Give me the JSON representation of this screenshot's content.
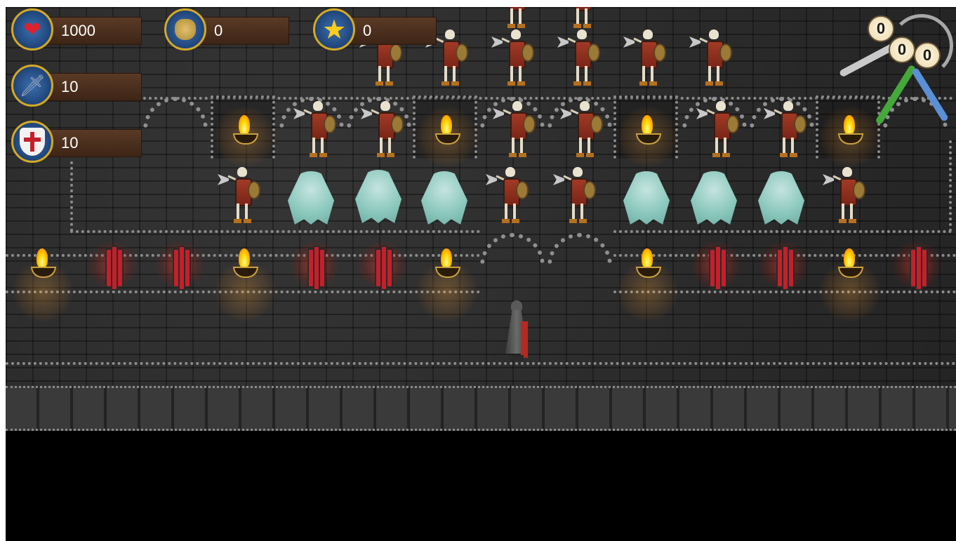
{
  "hud": {
    "health": {
      "icon": "heart-icon",
      "value": "1000"
    },
    "gold": {
      "icon": "gold-bag-icon",
      "value": "0"
    },
    "stars": {
      "icon": "star-icon",
      "value": "0"
    },
    "attack": {
      "icon": "sword-icon",
      "value": "10"
    },
    "defense": {
      "icon": "cross-shield-icon",
      "value": "10"
    }
  },
  "keys": {
    "grey_count": "0",
    "green_count": "0",
    "blue_count": "0"
  },
  "colors": {
    "background": "#2b2b2b",
    "letterbox": "#000000",
    "hud_plank": "#4a2f1d",
    "medal_rim": "#d4a928",
    "medal_fill": "#2c5a98",
    "torch_flame": "#ffd800",
    "spike_trap": "#c4202a",
    "ghost": "#92d1c6"
  },
  "entities": {
    "hero": "hero-knight",
    "enemies": [
      "skeleton-warrior",
      "ghost"
    ],
    "traps": [
      "spike-trap"
    ],
    "decor": [
      "wall-torch"
    ]
  }
}
